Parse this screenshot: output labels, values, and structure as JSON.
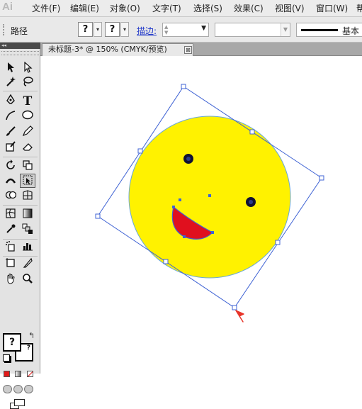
{
  "app": {
    "logo": "Ai"
  },
  "menu": [
    "文件(F)",
    "编辑(E)",
    "对象(O)",
    "文字(T)",
    "选择(S)",
    "效果(C)",
    "视图(V)",
    "窗口(W)",
    "帮"
  ],
  "control_bar": {
    "selection_label": "路径",
    "fill_value": "?",
    "stroke_value": "?",
    "stroke_label": "描边:",
    "stroke_weight": "",
    "variable_width": "",
    "brush_label": "基本"
  },
  "document": {
    "tab_title": "未标题-3* @ 150% (CMYK/预览)",
    "close_glyph": "⊠"
  },
  "tools": {
    "fill_value": "?",
    "stroke_value": "?",
    "swap_glyph": "↰"
  },
  "colors": {
    "face_fill": "#fff200",
    "face_stroke": "#6aa8d8",
    "mouth_fill": "#e0101e",
    "selection": "#3f63d4",
    "eye": "#111133",
    "cursor": "#e8352a"
  }
}
